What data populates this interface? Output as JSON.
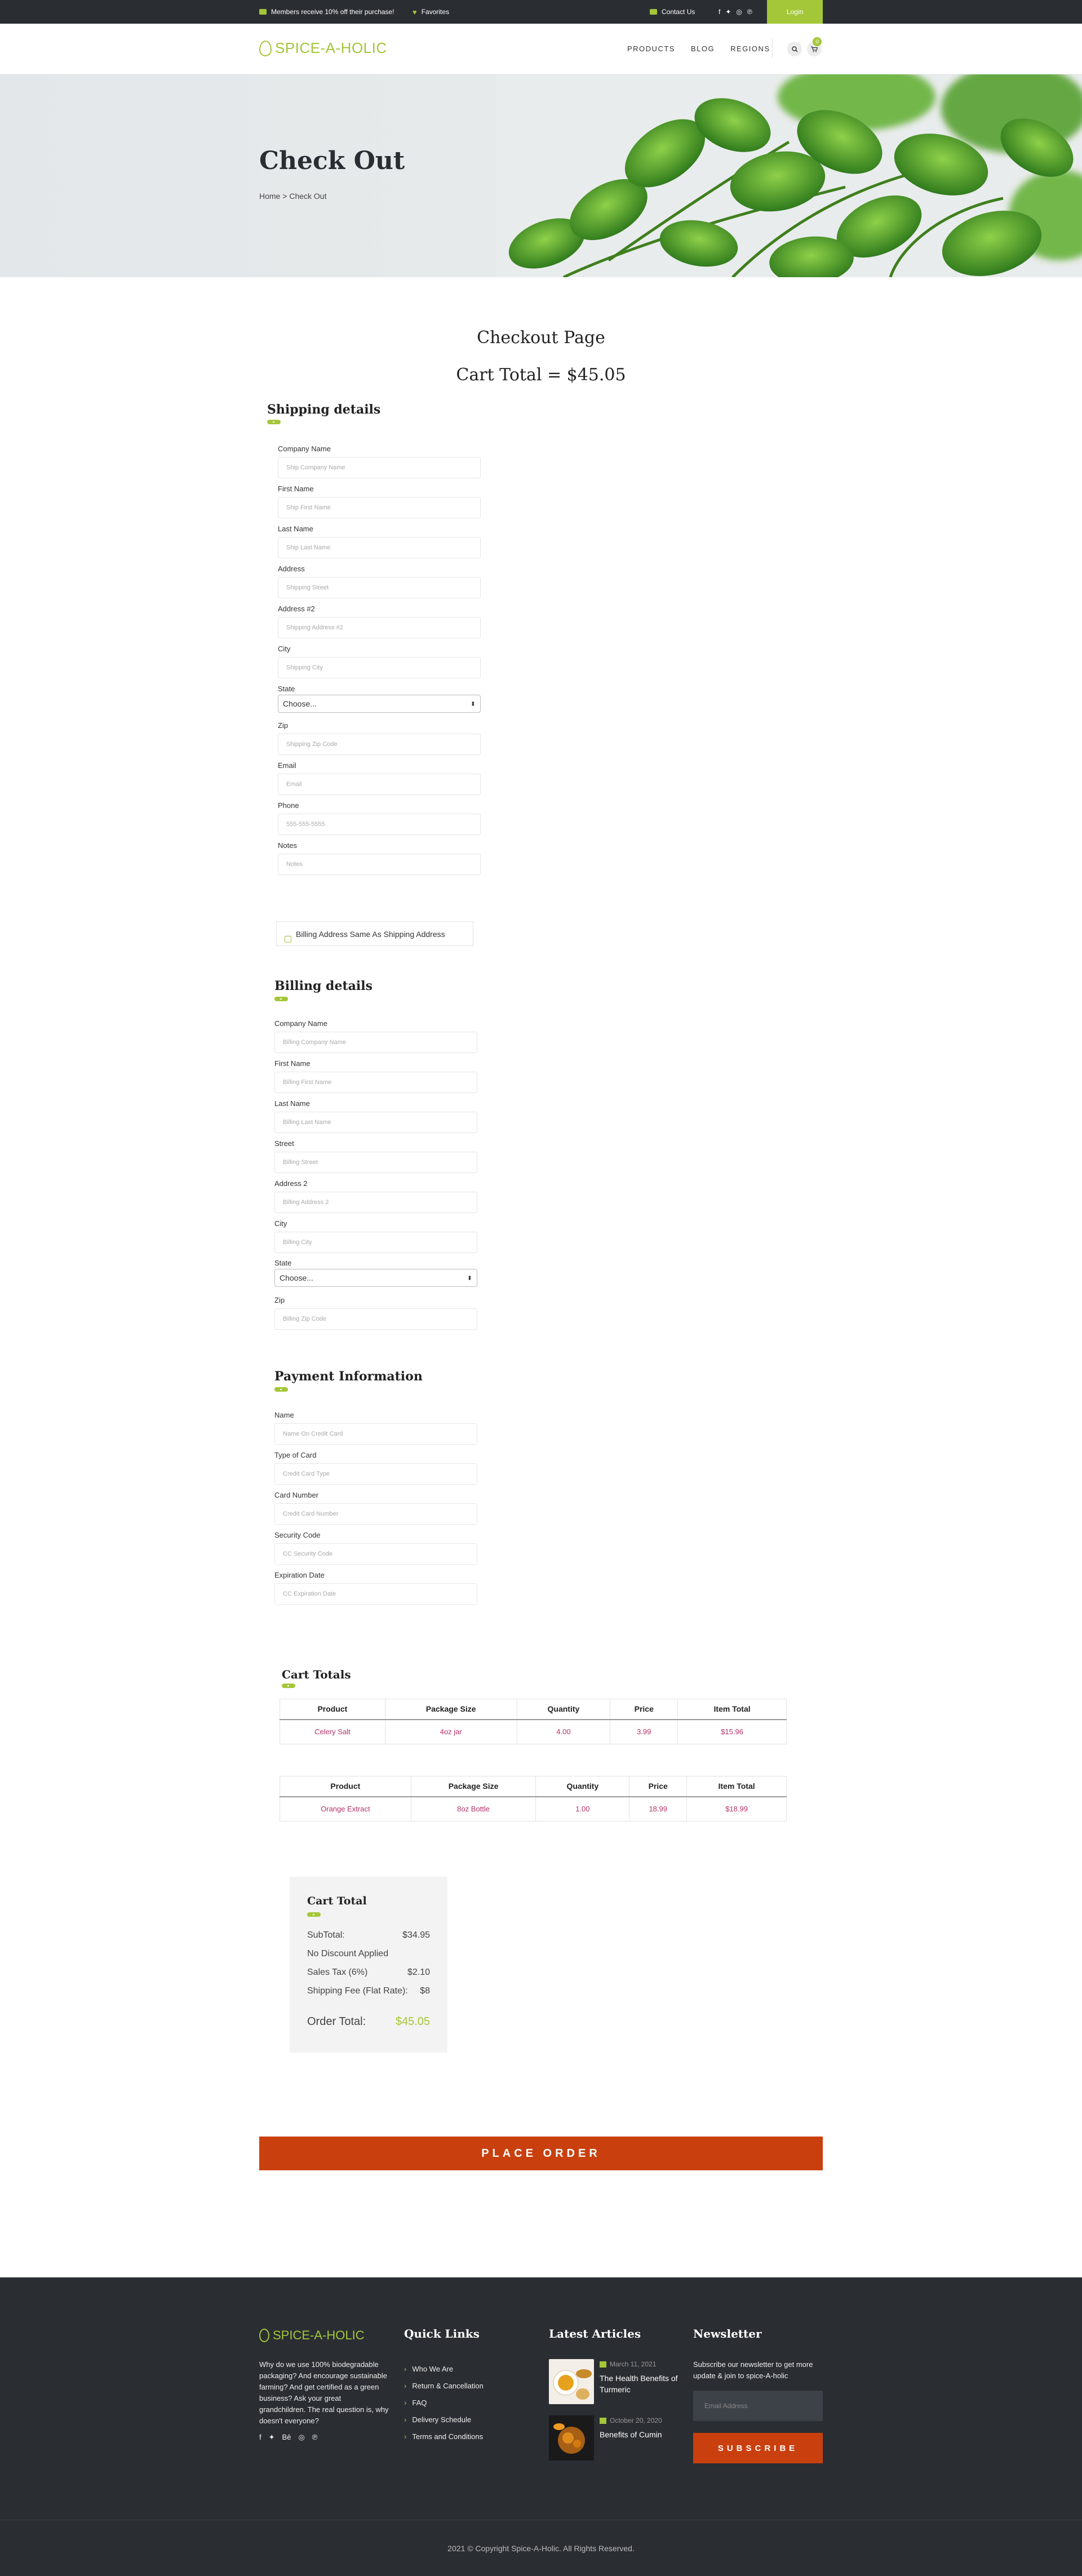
{
  "topbar": {
    "promo": "Members receive 10% off their purchase!",
    "favorites": "Favorites",
    "contact": "Contact Us",
    "login": "Login",
    "social_icons": [
      "facebook-icon",
      "twitter-icon",
      "instagram-icon",
      "pinterest-icon"
    ]
  },
  "header": {
    "logo": "SPICE-A-HOLIC",
    "nav": [
      "PRODUCTS",
      "BLOG",
      "REGIONS"
    ],
    "cart_count": "0"
  },
  "hero": {
    "title": "Check Out",
    "breadcrumb_home": "Home",
    "breadcrumb_sep": ">",
    "breadcrumb_current": "Check Out"
  },
  "page": {
    "heading": "Checkout Page",
    "cart_total": "Cart Total = $45.05"
  },
  "shipping": {
    "title": "Shipping details",
    "fields": [
      {
        "label": "Company Name",
        "placeholder": "Ship Company Name"
      },
      {
        "label": "First Name",
        "placeholder": "Ship First Name"
      },
      {
        "label": "Last Name",
        "placeholder": "Ship Last Name"
      },
      {
        "label": "Address",
        "placeholder": "Shipping Street"
      },
      {
        "label": "Address #2",
        "placeholder": "Shipping Address #2"
      },
      {
        "label": "City",
        "placeholder": "Shipping City"
      }
    ],
    "state_label": "State",
    "state_value": "Choose...",
    "fields2": [
      {
        "label": "Zip",
        "placeholder": "Shipping Zip Code"
      },
      {
        "label": "Email",
        "placeholder": "Email"
      },
      {
        "label": "Phone",
        "placeholder": "555-555-5555"
      },
      {
        "label": "Notes",
        "placeholder": "Notes"
      }
    ],
    "same_address": "Billing Address Same As Shipping Address"
  },
  "billing": {
    "title": "Billing details",
    "fields": [
      {
        "label": "Company Name",
        "placeholder": "Billing Company Name"
      },
      {
        "label": "First Name",
        "placeholder": "Billing First Name"
      },
      {
        "label": "Last Name",
        "placeholder": "Billing Last Name"
      },
      {
        "label": "Street",
        "placeholder": "Billing Street"
      },
      {
        "label": "Address 2",
        "placeholder": "Billing Address 2"
      },
      {
        "label": "City",
        "placeholder": "Billing City"
      }
    ],
    "state_label": "State",
    "state_value": "Choose...",
    "zip_label": "Zip",
    "zip_placeholder": "Billing Zip Code"
  },
  "payment": {
    "title": "Payment Information",
    "fields": [
      {
        "label": "Name",
        "placeholder": "Name On Credit Card"
      },
      {
        "label": "Type of Card",
        "placeholder": "Credit Card Type"
      },
      {
        "label": "Card Number",
        "placeholder": "Credit Card Number"
      },
      {
        "label": "Security Code",
        "placeholder": "CC Security Code"
      },
      {
        "label": "Expiration Date",
        "placeholder": "CC Expiration Date"
      }
    ]
  },
  "cart_totals": {
    "title": "Cart Totals",
    "headers": [
      "Product",
      "Package Size",
      "Quantity",
      "Price",
      "Item Total"
    ],
    "tables": [
      {
        "row": [
          "Celery Salt",
          "4oz jar",
          "4.00",
          "3.99",
          "$15.96"
        ]
      },
      {
        "row": [
          "Orange Extract",
          "8oz Bottle",
          "1.00",
          "18.99",
          "$18.99"
        ]
      }
    ]
  },
  "summary": {
    "title": "Cart Total",
    "subtotal_label": "SubTotal:",
    "subtotal_value": "$34.95",
    "discount": "No Discount Applied",
    "tax_label": "Sales Tax (6%)",
    "tax_value": "$2.10",
    "shipping_label": "Shipping Fee (Flat Rate):",
    "shipping_value": "$8",
    "order_label": "Order Total:",
    "order_value": "$45.05"
  },
  "place_order": "PLACE ORDER",
  "footer": {
    "logo": "SPICE-A-HOLIC",
    "about": "Why do we use 100% biodegradable packaging? And encourage sustainable farming? And get certified as a green business? Ask your great grandchildren. The real question is, why doesn't everyone?",
    "quick_title": "Quick Links",
    "quick_links": [
      "Who We Are",
      "Return & Cancellation",
      "FAQ",
      "Delivery Schedule",
      "Terms and Conditions"
    ],
    "articles_title": "Latest Articles",
    "articles": [
      {
        "date": "March 11, 2021",
        "title": "The Health Benefits of Turmeric"
      },
      {
        "date": "October 20, 2020",
        "title": "Benefits of Cumin"
      }
    ],
    "newsletter_title": "Newsletter",
    "newsletter_text": "Subscribe our newsletter to get more update & join to spice-A-holic",
    "email_placeholder": "Email Address",
    "subscribe": "SUBSCRIBE",
    "copyright": "2021 © Copyright Spice-A-Holic. All Rights Reserved.",
    "social_icons": [
      "facebook-icon",
      "twitter-icon",
      "behance-icon",
      "instagram-icon",
      "pinterest-icon"
    ]
  },
  "colors": {
    "accent": "#a4c639",
    "dark": "#2a2e33",
    "order_button": "#c9400e",
    "table_text": "#b5336b"
  }
}
